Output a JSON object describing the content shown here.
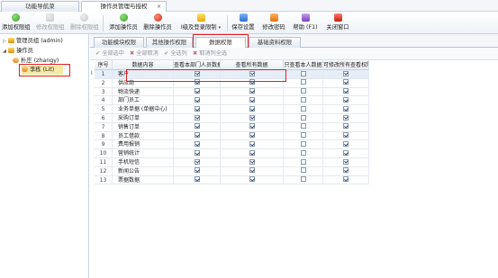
{
  "tabs": [
    {
      "label": "功能导航菜",
      "active": false
    },
    {
      "label": "操作员管理与授权",
      "active": true,
      "close": "×"
    }
  ],
  "toolbar": {
    "buttons": [
      {
        "label": "添加权限组",
        "icon": "add-icon",
        "disabled": false
      },
      {
        "label": "修改权限组",
        "icon": "edit-icon",
        "disabled": true
      },
      {
        "label": "删除权限组",
        "icon": "delete-icon",
        "disabled": true
      },
      {
        "label": "添加操作员",
        "icon": "add-user-icon",
        "disabled": false
      },
      {
        "label": "删除操作员",
        "icon": "delete-user-icon",
        "disabled": false
      },
      {
        "label": "I级及登录限制",
        "icon": "login-limit-icon",
        "disabled": false,
        "dropdown": "▾"
      },
      {
        "label": "保存设置",
        "icon": "save-icon",
        "disabled": false
      },
      {
        "label": "修改密码",
        "icon": "key-icon",
        "disabled": false
      },
      {
        "label": "帮助 (F1)",
        "icon": "help-icon",
        "disabled": false
      },
      {
        "label": "关闭窗口",
        "icon": "close-window-icon",
        "disabled": false
      }
    ]
  },
  "tree": {
    "nodes": [
      {
        "label": "管理员组 (admin)",
        "toggle": "▷",
        "level": 0
      },
      {
        "label": "操作员",
        "toggle": "◢",
        "level": 0
      },
      {
        "label": "朴庄 (zhangy)",
        "toggle": "",
        "level": 1
      },
      {
        "label": "李栋 (Lit)",
        "toggle": "",
        "level": 1,
        "selected": true
      }
    ]
  },
  "right_tabs": [
    {
      "label": "功能模块权限",
      "active": false
    },
    {
      "label": "其他操作权限",
      "active": false
    },
    {
      "label": "数据权限",
      "active": true
    },
    {
      "label": "基础资料权限",
      "active": false
    }
  ],
  "subbar": [
    {
      "mark": "✔",
      "label": "全部选中"
    },
    {
      "mark": "✖",
      "label": "全部取消"
    },
    {
      "mark": "✔",
      "label": "全选列"
    },
    {
      "mark": "✖",
      "label": "取消列全选"
    }
  ],
  "grid": {
    "columns": [
      "序号",
      "数据内容",
      "查看本部门人员数据",
      "查看所有数据",
      "只查看本人数据",
      "可修改所有查看权限的数据"
    ],
    "rows": [
      {
        "num": "1",
        "name": "客户",
        "c1": true,
        "c2": true,
        "c3": false,
        "c4": true
      },
      {
        "num": "2",
        "name": "供应商",
        "c1": true,
        "c2": true,
        "c3": false,
        "c4": true
      },
      {
        "num": "3",
        "name": "物流快递",
        "c1": true,
        "c2": true,
        "c3": false,
        "c4": true
      },
      {
        "num": "4",
        "name": "部门员工",
        "c1": true,
        "c2": true,
        "c3": false,
        "c4": true
      },
      {
        "num": "5",
        "name": "业务单据 (单据中心)",
        "c1": true,
        "c2": true,
        "c3": false,
        "c4": true
      },
      {
        "num": "6",
        "name": "采购订单",
        "c1": true,
        "c2": true,
        "c3": false,
        "c4": true
      },
      {
        "num": "7",
        "name": "销售订单",
        "c1": true,
        "c2": true,
        "c3": false,
        "c4": true
      },
      {
        "num": "8",
        "name": "员工借款",
        "c1": true,
        "c2": true,
        "c3": false,
        "c4": true
      },
      {
        "num": "9",
        "name": "费用报销",
        "c1": true,
        "c2": true,
        "c3": false,
        "c4": true
      },
      {
        "num": "10",
        "name": "营销统计",
        "c1": true,
        "c2": true,
        "c3": false,
        "c4": true
      },
      {
        "num": "11",
        "name": "手机短信",
        "c1": true,
        "c2": true,
        "c3": false,
        "c4": true
      },
      {
        "num": "12",
        "name": "新闻公告",
        "c1": true,
        "c2": true,
        "c3": false,
        "c4": true
      },
      {
        "num": "13",
        "name": "票据数据",
        "c1": true,
        "c2": true,
        "c3": false,
        "c4": true
      }
    ],
    "row_marker": "I"
  }
}
